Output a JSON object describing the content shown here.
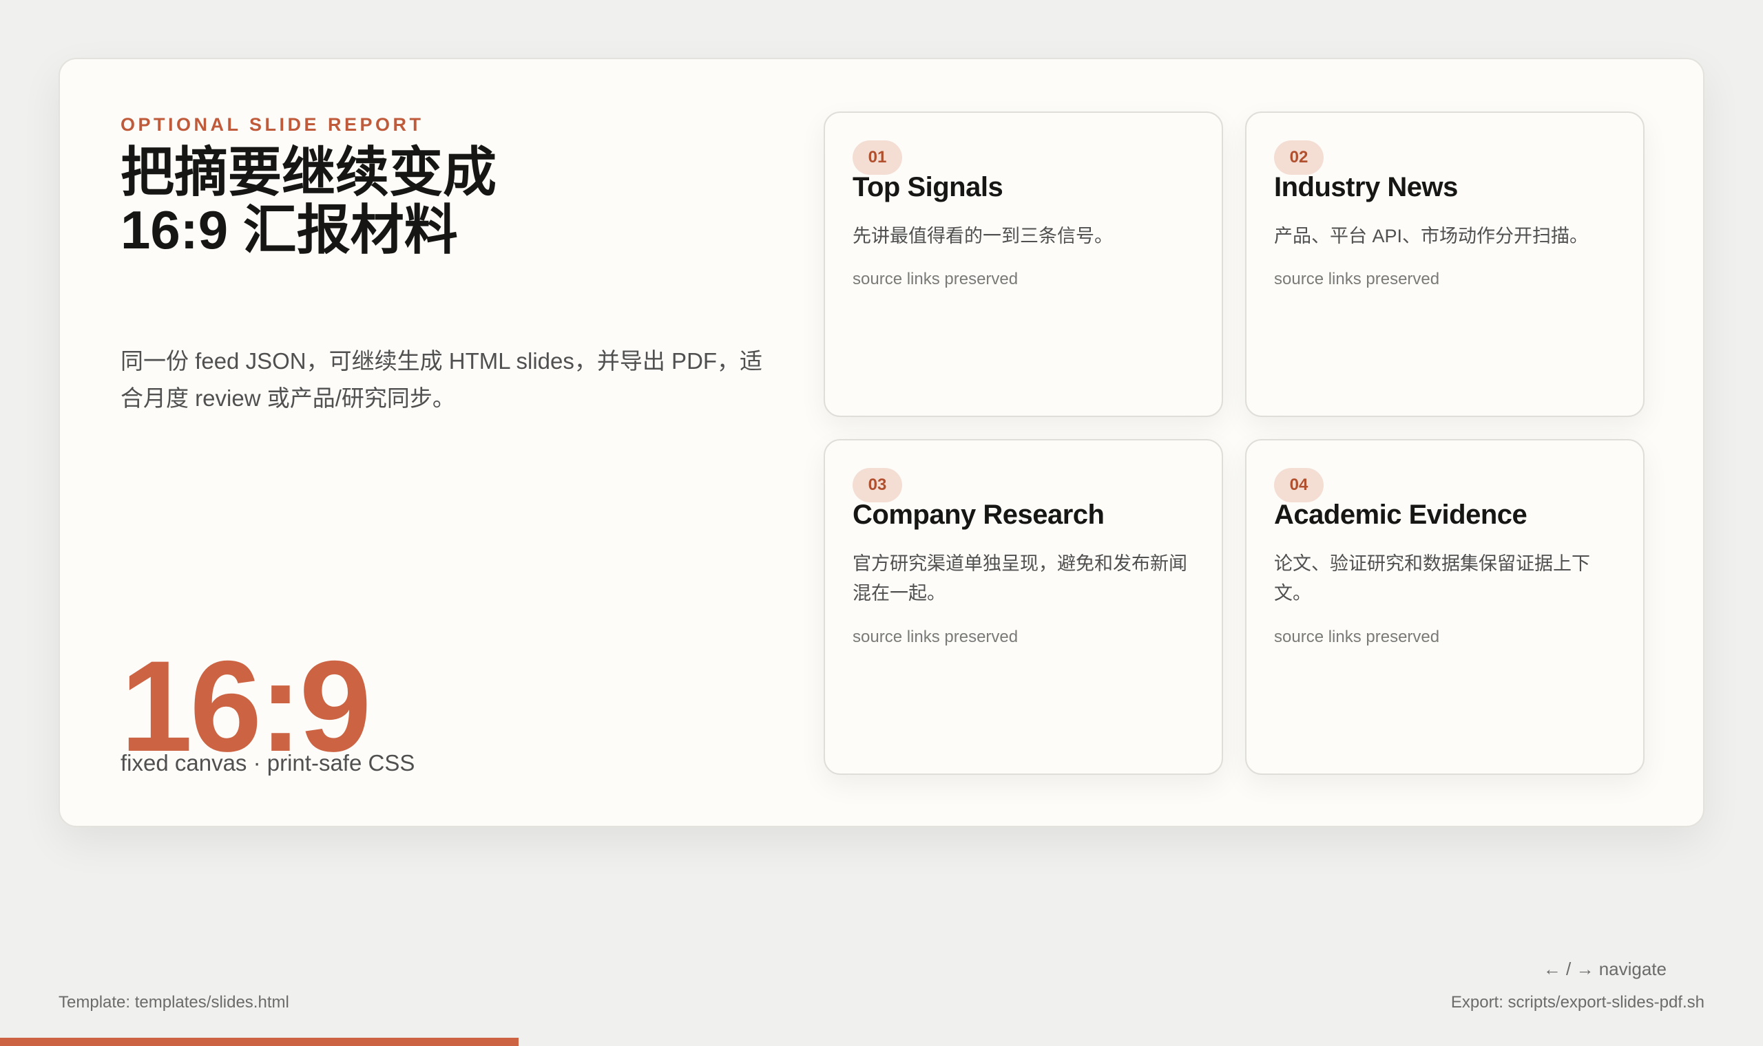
{
  "slide": {
    "eyebrow": "OPTIONAL SLIDE REPORT",
    "title_line1": "把摘要继续变成",
    "title_line2": "16:9 汇报材料",
    "description": "同一份 feed JSON，可继续生成 HTML slides，并导出 PDF，适合月度 review 或产品/研究同步。",
    "big_number": "16:9",
    "big_caption": "fixed canvas · print-safe CSS",
    "cards": [
      {
        "number": "01",
        "title": "Top Signals",
        "description": "先讲最值得看的一到三条信号。",
        "source": "source links preserved"
      },
      {
        "number": "02",
        "title": "Industry News",
        "description": "产品、平台 API、市场动作分开扫描。",
        "source": "source links preserved"
      },
      {
        "number": "03",
        "title": "Company Research",
        "description": "官方研究渠道单独呈现，避免和发布新闻混在一起。",
        "source": "source links preserved"
      },
      {
        "number": "04",
        "title": "Academic Evidence",
        "description": "论文、验证研究和数据集保留证据上下文。",
        "source": "source links preserved"
      }
    ]
  },
  "footer": {
    "template": "Template: templates/slides.html",
    "nav_hint": "← / → navigate",
    "export": "Export: scripts/export-slides-pdf.sh"
  },
  "progress": {
    "fraction": 0.294,
    "color": "#cc6444"
  },
  "colors": {
    "accent": "#cc6444",
    "badge_bg": "#f4ddd2",
    "background": "#f0f0ee",
    "slide_bg": "#fdfcf8"
  }
}
